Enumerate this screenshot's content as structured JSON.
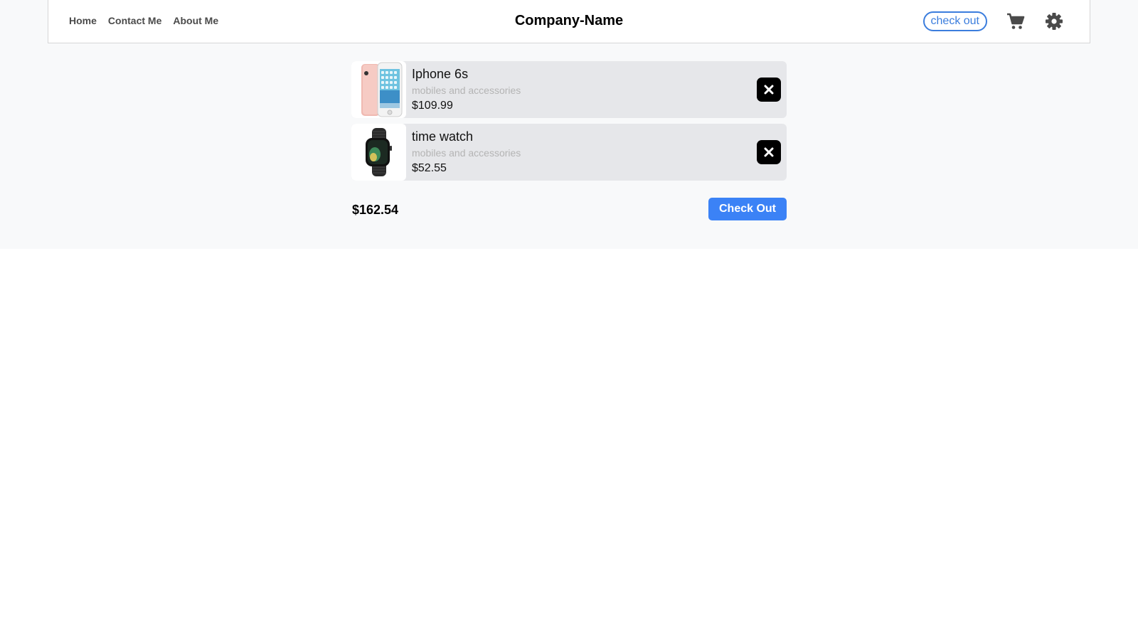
{
  "nav": {
    "links": [
      "Home",
      "Contact Me",
      "About Me"
    ],
    "brand": "Company-Name",
    "checkout_pill": "check out",
    "icons": [
      "cart-icon",
      "gear-icon"
    ]
  },
  "cart": {
    "items": [
      {
        "name": "Iphone 6s",
        "category": "mobiles and accessories",
        "price": "$109.99",
        "image": "iphone-image"
      },
      {
        "name": "time watch",
        "category": "mobiles and accessories",
        "price": "$52.55",
        "image": "smartwatch-image"
      }
    ],
    "total": "$162.54",
    "checkout_label": "Check Out"
  },
  "colors": {
    "accent": "#3b82f6",
    "pill_border": "#3b7ddd",
    "item_bg": "#e6e7ea",
    "page_bg": "#f8f9fa"
  }
}
